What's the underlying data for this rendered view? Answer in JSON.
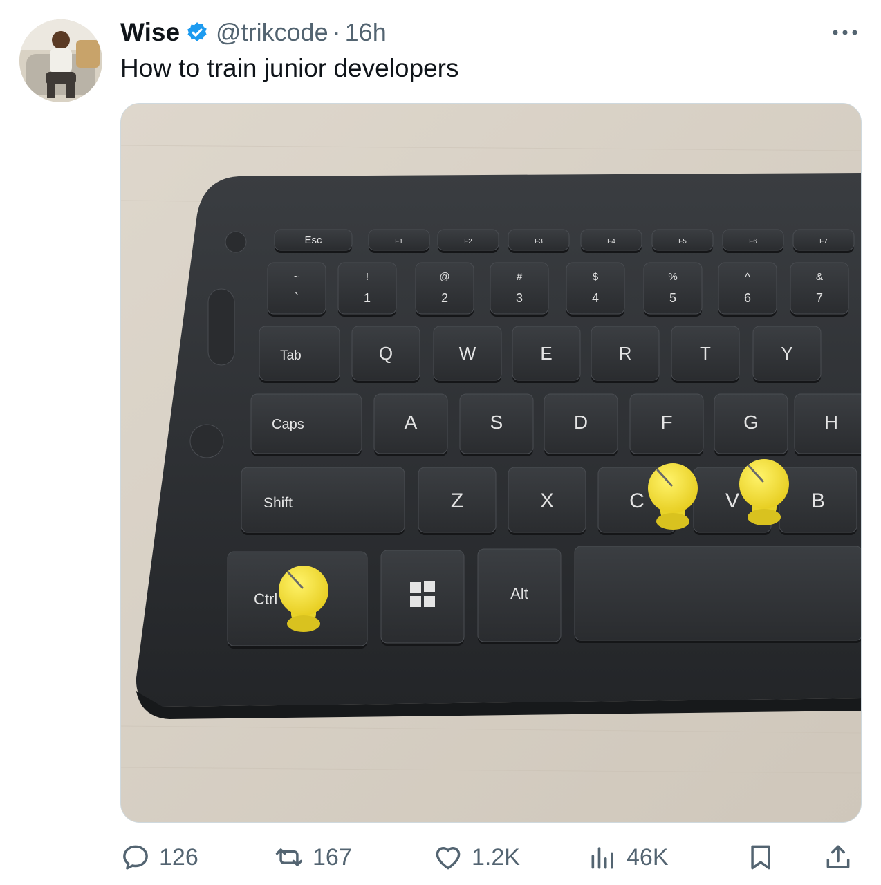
{
  "post": {
    "author_name": "Wise",
    "handle": "@trikcode",
    "separator": "·",
    "time": "16h",
    "text": "How to train junior developers"
  },
  "icons": {
    "verified": "verified-badge-icon",
    "more": "more-options-icon",
    "reply": "reply-icon",
    "repost": "repost-icon",
    "like": "like-icon",
    "views": "views-icon",
    "bookmark": "bookmark-icon",
    "share": "share-icon"
  },
  "colors": {
    "verified_blue": "#1d9bf0",
    "secondary_text": "#536471",
    "pin_yellow": "#f2df38",
    "keyboard": "#2b2e31"
  },
  "stats": {
    "replies": "126",
    "reposts": "167",
    "likes": "1.2K",
    "views": "46K"
  },
  "keyboard": {
    "function_row": [
      "Esc",
      "F1",
      "F2",
      "F3",
      "F4",
      "F5",
      "F6",
      "F7"
    ],
    "number_row": [
      {
        "top": "~",
        "bottom": "`"
      },
      {
        "top": "!",
        "bottom": "1"
      },
      {
        "top": "@",
        "bottom": "2"
      },
      {
        "top": "#",
        "bottom": "3"
      },
      {
        "top": "$",
        "bottom": "4"
      },
      {
        "top": "%",
        "bottom": "5"
      },
      {
        "top": "^",
        "bottom": "6"
      },
      {
        "top": "&",
        "bottom": "7"
      }
    ],
    "top_row": [
      "Tab",
      "Q",
      "W",
      "E",
      "R",
      "T",
      "Y"
    ],
    "home_row": [
      "Caps",
      "A",
      "S",
      "D",
      "F",
      "G",
      "H"
    ],
    "bottom_row": [
      "Shift",
      "Z",
      "X",
      "C",
      "V",
      "B"
    ],
    "space_row": [
      "Ctrl",
      "Alt"
    ],
    "pinned_keys": [
      "Ctrl",
      "C",
      "V"
    ]
  }
}
